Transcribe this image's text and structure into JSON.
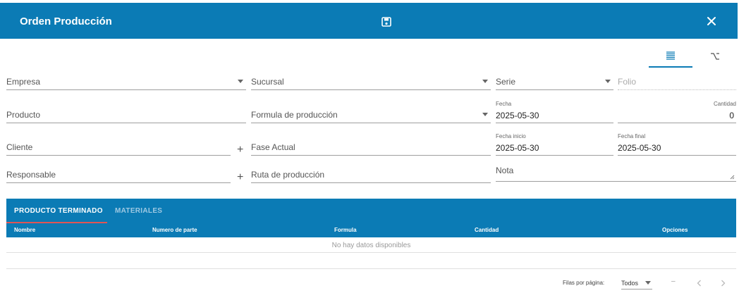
{
  "header": {
    "title": "Orden Producción",
    "save_icon": "save-icon",
    "close_icon": "close-icon",
    "background": "#0b7bb5"
  },
  "view_toggle": [
    {
      "icon": "list-icon",
      "active": true
    },
    {
      "icon": "option-key-icon",
      "active": false
    }
  ],
  "form": {
    "empresa": {
      "label": "Empresa"
    },
    "sucursal": {
      "label": "Sucursal"
    },
    "serie": {
      "label": "Serie"
    },
    "folio": {
      "label": "Folio"
    },
    "producto": {
      "label": "Producto"
    },
    "formula": {
      "label": "Formula de producción"
    },
    "fecha": {
      "label": "Fecha",
      "value": "2025-05-30"
    },
    "cantidad": {
      "label": "Cantidad",
      "value": "0"
    },
    "cliente": {
      "label": "Cliente"
    },
    "fase_actual": {
      "label": "Fase Actual"
    },
    "fecha_inicio": {
      "label": "Fecha inicio",
      "value": "2025-05-30"
    },
    "fecha_final": {
      "label": "Fecha final",
      "value": "2025-05-30"
    },
    "responsable": {
      "label": "Responsable"
    },
    "ruta": {
      "label": "Ruta de producción"
    },
    "nota": {
      "label": "Nota"
    },
    "add_symbol": "+"
  },
  "tabs": [
    {
      "label": "PRODUCTO TERMINADO",
      "active": true
    },
    {
      "label": "MATERIALES",
      "active": false
    }
  ],
  "table": {
    "columns": [
      "Nombre",
      "Numero de parte",
      "Formula",
      "Cantidad",
      "Opciones"
    ],
    "empty_text": "No hay datos disponibles"
  },
  "pagination": {
    "rows_per_page_label": "Filas por página:",
    "rows_per_page_value": "Todos",
    "range_text": "–"
  }
}
